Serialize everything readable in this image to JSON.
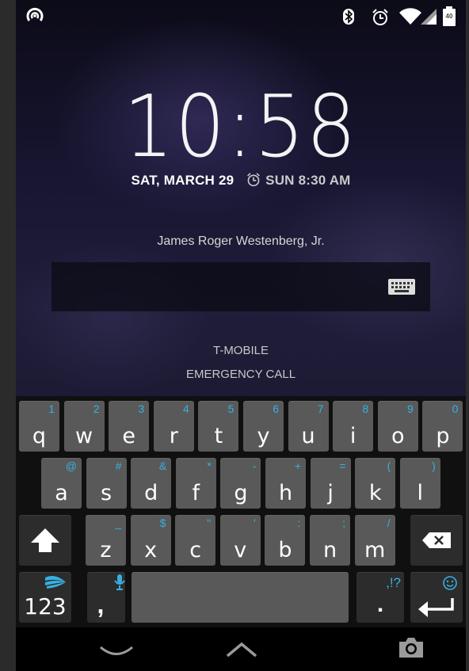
{
  "status_bar": {
    "left_icon": "app-notification-icon",
    "right_icons": [
      "bluetooth-icon",
      "alarm-icon",
      "wifi-icon",
      "signal-icon",
      "battery-icon"
    ],
    "battery_level": "40"
  },
  "lockscreen": {
    "time": "10:58",
    "date": "SAT, MARCH 29",
    "next_alarm": "SUN 8:30 AM",
    "owner_info": "James Roger Westenberg, Jr.",
    "password_value": "",
    "carrier": "T-MOBILE",
    "emergency_call": "EMERGENCY CALL"
  },
  "keyboard": {
    "row1": [
      {
        "main": "q",
        "alt": "1"
      },
      {
        "main": "w",
        "alt": "2"
      },
      {
        "main": "e",
        "alt": "3"
      },
      {
        "main": "r",
        "alt": "4"
      },
      {
        "main": "t",
        "alt": "5"
      },
      {
        "main": "y",
        "alt": "6"
      },
      {
        "main": "u",
        "alt": "7"
      },
      {
        "main": "i",
        "alt": "8"
      },
      {
        "main": "o",
        "alt": "9"
      },
      {
        "main": "p",
        "alt": "0"
      }
    ],
    "row2": [
      {
        "main": "a",
        "alt": "@"
      },
      {
        "main": "s",
        "alt": "#"
      },
      {
        "main": "d",
        "alt": "&"
      },
      {
        "main": "f",
        "alt": "*"
      },
      {
        "main": "g",
        "alt": "-"
      },
      {
        "main": "h",
        "alt": "+"
      },
      {
        "main": "j",
        "alt": "="
      },
      {
        "main": "k",
        "alt": "("
      },
      {
        "main": "l",
        "alt": ")"
      }
    ],
    "row3": [
      {
        "main": "z",
        "alt": "_"
      },
      {
        "main": "x",
        "alt": "$"
      },
      {
        "main": "c",
        "alt": "\""
      },
      {
        "main": "v",
        "alt": "'"
      },
      {
        "main": "b",
        "alt": ":"
      },
      {
        "main": "n",
        "alt": ";"
      },
      {
        "main": "m",
        "alt": "/"
      }
    ],
    "numbers_label": "123",
    "comma_label": ",",
    "period_label": ".",
    "punct_alt": ",!?",
    "accent_color": "#37b0e0"
  },
  "navbar": {
    "icons": [
      "hide-keyboard-icon",
      "home-up-icon",
      "camera-icon"
    ]
  }
}
